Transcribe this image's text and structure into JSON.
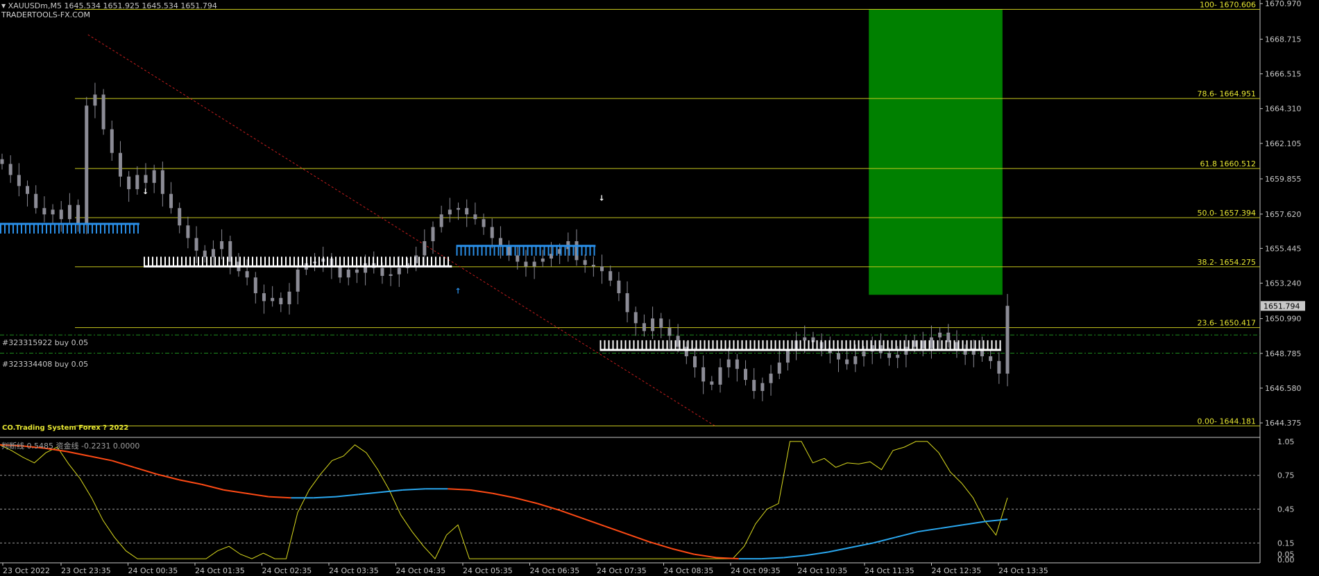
{
  "header": {
    "symbol_line": "XAUUSDm,M5  1645.534 1651.925 1645.534 1651.794",
    "watermark": "TRADERTOOLS-FX.COM"
  },
  "orders": [
    {
      "label": "#323315922 buy 0.05",
      "price": 1649.95
    },
    {
      "label": "#323334408 buy 0.05",
      "price": 1648.8
    }
  ],
  "system_label": "CO.Trading System Forex  ? 2022",
  "osc_label": "判断线 0.5485  资金线 -0.2231 0.0000",
  "colors": {
    "background": "#000000",
    "fib": "#c8c81e",
    "fib_text": "#e6e632",
    "up_band": "#2a8fe8",
    "down_band": "#ffffff",
    "candle": "#8c8c96",
    "green_box": "#008000",
    "order_line": "#1e8c1e",
    "trend_line": "#c81e1e",
    "osc_yellow": "#dcdc1e",
    "osc_red": "#ff4a14",
    "osc_blue": "#2aa8f0",
    "axis_text": "#c8c8c8"
  },
  "chart_data": [
    {
      "type": "candlestick",
      "title": "XAUUSDm,M5",
      "ylim": [
        1643.5,
        1671.2
      ],
      "yticks": [
        1670.97,
        1668.715,
        1666.515,
        1664.31,
        1662.105,
        1659.855,
        1657.62,
        1655.445,
        1653.24,
        1650.99,
        1648.785,
        1646.58,
        1644.375
      ],
      "yticks_text": [
        "1670.970",
        "1668.715",
        "1666.515",
        "1664.310",
        "1662.105",
        "1659.855",
        "1657.620",
        "1655.445",
        "1653.240",
        "1650.990",
        "1648.785",
        "1646.580",
        "1644.375"
      ],
      "current_price": "1651.794",
      "fib_levels": [
        {
          "label": "100- 1670.606",
          "price": 1670.606
        },
        {
          "label": "78.6- 1664.951",
          "price": 1664.951
        },
        {
          "label": "61.8 1660.512",
          "price": 1660.512
        },
        {
          "label": "50.0- 1657.394",
          "price": 1657.394
        },
        {
          "label": "38.2- 1654.275",
          "price": 1654.275
        },
        {
          "label": "23.6- 1650.417",
          "price": 1650.417
        },
        {
          "label": "0.00- 1644.181",
          "price": 1644.181
        }
      ],
      "xticks": [
        "23 Oct 2022",
        "23 Oct 23:35",
        "24 Oct 00:35",
        "24 Oct 01:35",
        "24 Oct 02:35",
        "24 Oct 03:35",
        "24 Oct 04:35",
        "24 Oct 05:35",
        "24 Oct 06:35",
        "24 Oct 07:35",
        "24 Oct 08:35",
        "24 Oct 09:35",
        "24 Oct 10:35",
        "24 Oct 11:35",
        "24 Oct 12:35",
        "24 Oct 13:35"
      ],
      "candle_closes": [
        1660.8,
        1660.1,
        1659.4,
        1658.9,
        1658.0,
        1657.6,
        1657.9,
        1657.3,
        1658.2,
        1657.0,
        1664.5,
        1665.2,
        1663.0,
        1661.5,
        1660.0,
        1659.2,
        1660.1,
        1659.6,
        1660.4,
        1658.9,
        1658.0,
        1656.9,
        1656.1,
        1655.3,
        1654.9,
        1655.4,
        1655.9,
        1654.6,
        1654.0,
        1653.6,
        1652.6,
        1652.1,
        1652.3,
        1651.9,
        1652.7,
        1654.1,
        1654.5,
        1654.6,
        1654.8,
        1654.3,
        1653.6,
        1654.1,
        1653.9,
        1654.5,
        1654.2,
        1653.7,
        1653.8,
        1654.2,
        1654.5,
        1655.0,
        1655.9,
        1656.8,
        1657.6,
        1657.9,
        1658.0,
        1657.6,
        1657.3,
        1656.8,
        1656.1,
        1655.6,
        1655.0,
        1654.6,
        1654.3,
        1654.6,
        1654.8,
        1655.1,
        1655.4,
        1655.9,
        1654.7,
        1654.4,
        1654.3,
        1654.0,
        1653.4,
        1652.6,
        1651.4,
        1650.7,
        1650.2,
        1651.0,
        1650.4,
        1649.9,
        1649.2,
        1648.6,
        1647.9,
        1647.0,
        1646.8,
        1647.9,
        1648.4,
        1647.8,
        1647.1,
        1646.4,
        1646.9,
        1647.5,
        1648.2,
        1649.0,
        1649.6,
        1649.8,
        1649.5,
        1649.1,
        1648.8,
        1648.4,
        1648.1,
        1648.6,
        1648.9,
        1649.3,
        1648.8,
        1648.5,
        1648.7,
        1649.2,
        1649.6,
        1649.1,
        1649.8,
        1650.1,
        1649.5,
        1649.0,
        1648.7,
        1649.1,
        1648.6,
        1648.3,
        1647.5,
        1651.8
      ],
      "band_up": [
        {
          "i0": 0,
          "i1": 16,
          "price": 1657.0
        },
        {
          "i0": 54,
          "i1": 70,
          "price": 1655.6
        }
      ],
      "band_down": [
        {
          "i0": 17,
          "i1": 53,
          "price": 1654.3
        },
        {
          "i0": 71,
          "i1": 118,
          "price": 1649.0
        }
      ],
      "arrows": [
        {
          "type": "down",
          "i": 17,
          "price": 1659.1
        },
        {
          "type": "up",
          "i": 54,
          "price": 1652.8
        },
        {
          "type": "down",
          "i": 71,
          "price": 1658.7
        }
      ],
      "target_box": {
        "i0": 103,
        "i1": 118,
        "price_top": 1670.606,
        "price_bottom": 1652.5
      }
    },
    {
      "type": "line",
      "ylim": [
        -0.02,
        1.08
      ],
      "yticks": [
        1.05,
        0.75,
        0.45,
        0.15,
        0.05,
        0.0
      ],
      "yticks_text": [
        "1.05",
        "0.75",
        "0.45",
        "0.15",
        "0.05",
        "0.00"
      ],
      "series": [
        {
          "name": "判断线",
          "color": "#dcdc1e",
          "values": [
            1.02,
            0.97,
            0.91,
            0.86,
            0.95,
            1.0,
            0.85,
            0.72,
            0.55,
            0.35,
            0.2,
            0.08,
            0.01,
            0.01,
            0.01,
            0.01,
            0.01,
            0.01,
            0.01,
            0.08,
            0.12,
            0.05,
            0.01,
            0.06,
            0.01,
            0.01,
            0.42,
            0.62,
            0.76,
            0.88,
            0.92,
            1.02,
            0.95,
            0.8,
            0.62,
            0.4,
            0.25,
            0.12,
            0.01,
            0.22,
            0.31,
            0.01,
            0.01,
            0.01,
            0.01,
            0.01,
            0.01,
            0.01,
            0.01,
            0.01,
            0.01,
            0.01,
            0.01,
            0.01,
            0.01,
            0.01,
            0.01,
            0.01,
            0.01,
            0.01,
            0.01,
            0.01,
            0.01,
            0.01,
            0.01,
            0.12,
            0.32,
            0.45,
            0.5,
            1.05,
            1.05,
            0.86,
            0.9,
            0.82,
            0.86,
            0.85,
            0.87,
            0.8,
            0.97,
            1.0,
            1.05,
            1.05,
            0.95,
            0.78,
            0.68,
            0.55,
            0.35,
            0.22,
            0.55
          ]
        },
        {
          "name": "资金线",
          "color": "#ff4a14",
          "values": [
            1.02,
            1.01,
            0.99,
            0.96,
            0.92,
            0.88,
            0.82,
            0.76,
            0.71,
            0.67,
            0.62,
            0.59,
            0.56,
            0.55,
            0.55,
            0.56,
            0.58,
            0.6,
            0.62,
            0.63,
            0.63,
            0.62,
            0.59,
            0.55,
            0.5,
            0.44,
            0.37,
            0.3,
            0.23,
            0.16,
            0.1,
            0.05,
            0.02,
            0.01,
            0.01,
            0.02,
            0.04,
            0.07,
            0.11,
            0.15,
            0.2,
            0.25,
            0.28,
            0.31,
            0.34,
            0.36
          ]
        }
      ]
    }
  ]
}
